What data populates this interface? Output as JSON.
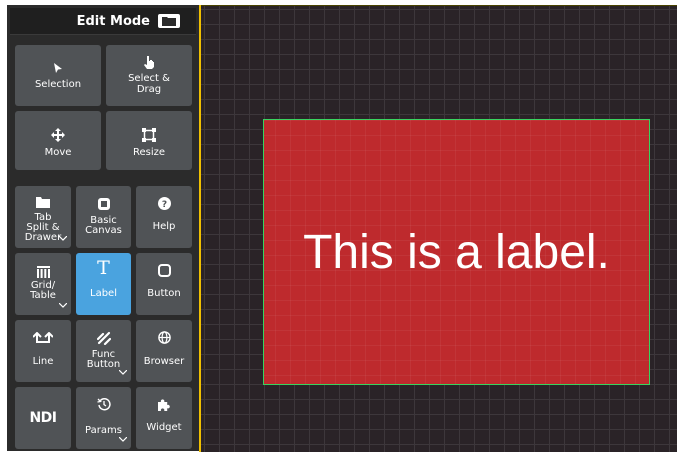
{
  "edit_bar": {
    "title": "Edit Mode",
    "folder_icon": "folder-icon"
  },
  "tools": {
    "selection": {
      "label": "Selection",
      "icon": "cursor-arrow-icon"
    },
    "select_drag": {
      "label1": "Select &",
      "label2": "Drag",
      "icon": "hand-pointer-icon"
    },
    "move": {
      "label": "Move",
      "icon": "move-arrows-icon"
    },
    "resize": {
      "label": "Resize",
      "icon": "resize-frame-icon"
    }
  },
  "widgets": {
    "tab_split": {
      "l1": "Tab",
      "l2": "Split &",
      "l3": "Drawer",
      "icon": "folder-tab-icon"
    },
    "basic_canvas": {
      "l1": "Basic",
      "l2": "Canvas",
      "icon": "square-icon"
    },
    "help": {
      "label": "Help",
      "icon": "question-circle-icon"
    },
    "grid_table": {
      "l1": "Grid/",
      "l2": "Table",
      "icon": "table-icon"
    },
    "label": {
      "label": "Label",
      "glyph": "T",
      "icon": "text-t-icon"
    },
    "button": {
      "label": "Button",
      "icon": "rounded-square-icon"
    },
    "line": {
      "label": "Line",
      "icon": "line-arrows-icon"
    },
    "func_button": {
      "l1": "Func",
      "l2": "Button",
      "icon": "link-icon"
    },
    "browser": {
      "label": "Browser",
      "icon": "globe-icon"
    },
    "ndi": {
      "label": "NDI"
    },
    "params": {
      "label": "Params",
      "icon": "history-icon"
    },
    "widget": {
      "label": "Widget",
      "icon": "puzzle-icon"
    }
  },
  "canvas": {
    "label_text": "This is a label."
  },
  "colors": {
    "active": "#4aa3df",
    "label_bg": "#be2a2d",
    "selection": "#39d35f",
    "canvas": "#2a2327",
    "edge": "#f0c000"
  }
}
